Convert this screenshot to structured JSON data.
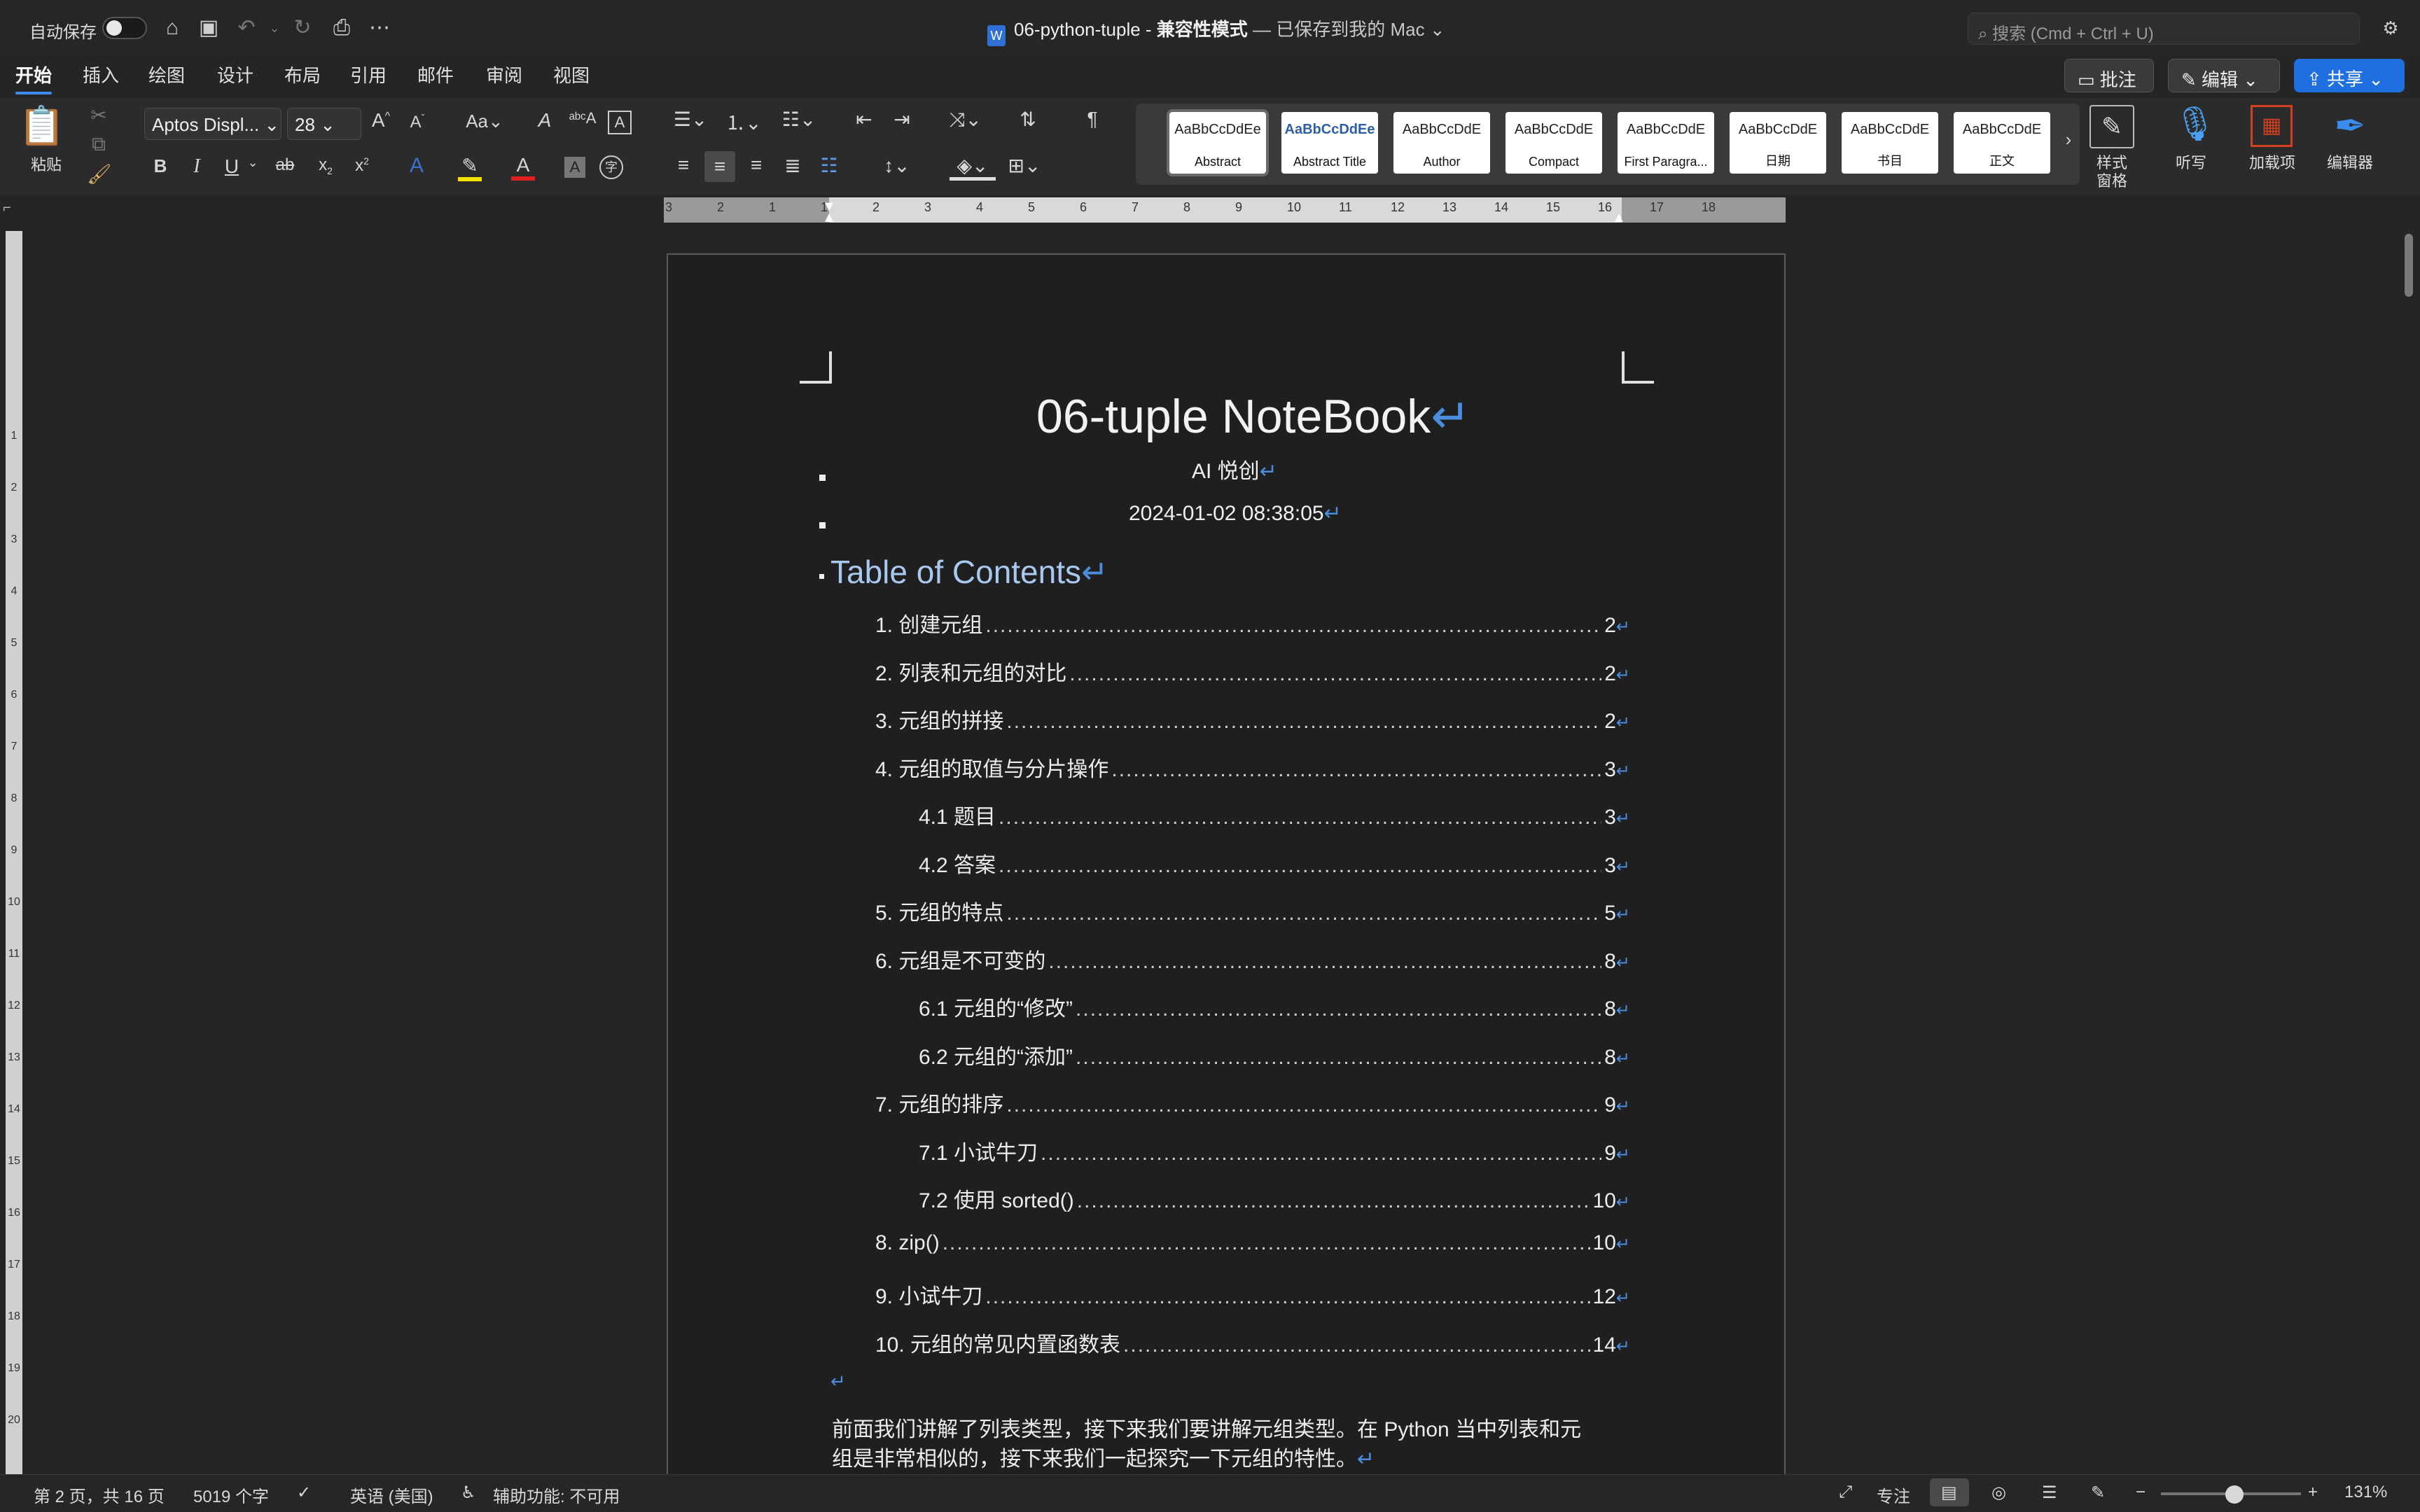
{
  "titlebar": {
    "autosave_label": "自动保存",
    "doc_name": "06-python-tuple",
    "separator": " - ",
    "mode": "兼容性模式",
    "saved_status": " — 已保存到我的 Mac",
    "search_placeholder": "搜索 (Cmd + Ctrl + U)"
  },
  "tabs": [
    "开始",
    "插入",
    "绘图",
    "设计",
    "布局",
    "引用",
    "邮件",
    "审阅",
    "视图"
  ],
  "actions": {
    "comments": "批注",
    "editing": "编辑",
    "share": "共享"
  },
  "ribbon": {
    "paste_label": "粘贴",
    "font_name": "Aptos Displ...",
    "font_size": "28",
    "styles": [
      {
        "sample": "AaBbCcDdEe",
        "name": "Abstract"
      },
      {
        "sample": "AaBbCcDdEe",
        "name": "Abstract Title"
      },
      {
        "sample": "AaBbCcDdE",
        "name": "Author"
      },
      {
        "sample": "AaBbCcDdE",
        "name": "Compact"
      },
      {
        "sample": "AaBbCcDdE",
        "name": "First Paragra..."
      },
      {
        "sample": "AaBbCcDdE",
        "name": "日期"
      },
      {
        "sample": "AaBbCcDdE",
        "name": "书目"
      },
      {
        "sample": "AaBbCcDdE",
        "name": "正文"
      }
    ],
    "styles_pane_label": "样式\n窗格",
    "dictate_label": "听写",
    "addins_label": "加载项",
    "editor_label": "编辑器"
  },
  "ruler": {
    "h_numbers": [
      "3",
      "2",
      "1",
      "1",
      "2",
      "3",
      "4",
      "5",
      "6",
      "7",
      "8",
      "9",
      "10",
      "11",
      "12",
      "13",
      "14",
      "15",
      "16",
      "17",
      "18"
    ],
    "v_numbers": [
      "1",
      "2",
      "3",
      "4",
      "5",
      "6",
      "7",
      "8",
      "9",
      "10",
      "11",
      "12",
      "13",
      "14",
      "15",
      "16",
      "17",
      "18",
      "19",
      "20"
    ]
  },
  "document": {
    "title": "06-tuple NoteBook",
    "author": "AI 悦创",
    "date": "2024-01-02 08:38:05",
    "toc_heading": "Table of Contents",
    "toc": [
      {
        "text": "1. 创建元组",
        "page": "2",
        "level": 1
      },
      {
        "text": "2. 列表和元组的对比",
        "page": "2",
        "level": 1
      },
      {
        "text": "3. 元组的拼接",
        "page": "2",
        "level": 1
      },
      {
        "text": "4. 元组的取值与分片操作",
        "page": "3",
        "level": 1
      },
      {
        "text": "4.1 题目",
        "page": "3",
        "level": 2
      },
      {
        "text": "4.2 答案",
        "page": "3",
        "level": 2
      },
      {
        "text": "5. 元组的特点",
        "page": "5",
        "level": 1
      },
      {
        "text": "6. 元组是不可变的",
        "page": "8",
        "level": 1
      },
      {
        "text": "6.1 元组的“修改”",
        "page": "8",
        "level": 2
      },
      {
        "text": "6.2 元组的“添加”",
        "page": "8",
        "level": 2
      },
      {
        "text": "7. 元组的排序",
        "page": "9",
        "level": 1
      },
      {
        "text": "7.1 小试牛刀",
        "page": "9",
        "level": 2
      },
      {
        "text": "7.2 使用 sorted()",
        "page": "10",
        "level": 2
      },
      {
        "text": "8. zip()",
        "page": "10",
        "level": 1
      },
      {
        "text": "9. 小试牛刀",
        "page": "12",
        "level": 1
      },
      {
        "text": "10. 元组的常见内置函数表",
        "page": "14",
        "level": 1
      }
    ],
    "body_line1": "前面我们讲解了列表类型，接下来我们要讲解元组类型。在 Python 当中列表和元",
    "body_line2": "组是非常相似的，接下来我们一起探究一下元组的特性。",
    "para_mark": "↵"
  },
  "status": {
    "page_info": "第 2 页，共 16 页",
    "word_count": "5019 个字",
    "language": "英语 (美国)",
    "accessibility": "辅助功能: 不可用",
    "focus": "专注",
    "zoom": "131%"
  },
  "colors": {
    "accent": "#3c8cf0",
    "share_button": "#1f6fe0",
    "paragraph_mark": "#4a8ddc",
    "toc_heading": "#a8c8f0"
  }
}
